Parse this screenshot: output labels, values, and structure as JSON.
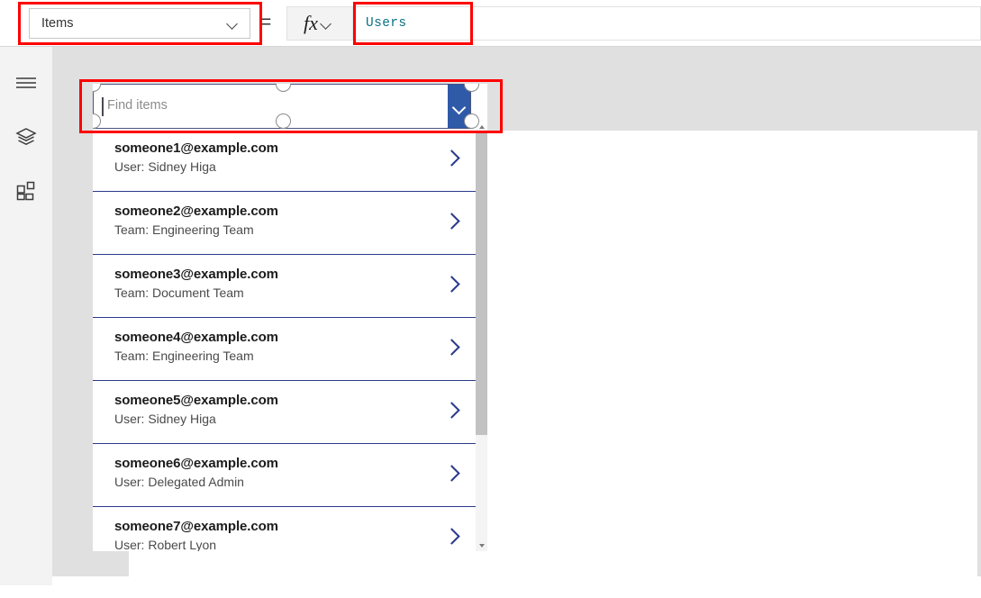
{
  "toolbar": {
    "property_label": "Items",
    "property_chevron_icon": "chevron-down-icon",
    "equals": "=",
    "fx_label": "fx",
    "fx_chevron_icon": "chevron-down-icon",
    "formula_value": "Users",
    "formula_color": "#0b7285"
  },
  "rail": {
    "items": [
      {
        "name": "menu",
        "icon": "hamburger-menu-icon"
      },
      {
        "name": "tree-view",
        "icon": "layers-icon"
      },
      {
        "name": "insert",
        "icon": "components-grid-icon"
      }
    ]
  },
  "list_control": {
    "search": {
      "placeholder": "Find items",
      "value": "",
      "dropdown_icon": "chevron-down-icon",
      "dropdown_color": "#2e5aa8",
      "selected": true
    },
    "row_chevron_icon": "chevron-right-icon",
    "separator_color": "#2b3a8c",
    "items": [
      {
        "title": "someone1@example.com",
        "subtitle": "User: Sidney Higa"
      },
      {
        "title": "someone2@example.com",
        "subtitle": "Team: Engineering Team"
      },
      {
        "title": "someone3@example.com",
        "subtitle": "Team: Document Team"
      },
      {
        "title": "someone4@example.com",
        "subtitle": "Team: Engineering Team"
      },
      {
        "title": "someone5@example.com",
        "subtitle": "User: Sidney Higa"
      },
      {
        "title": "someone6@example.com",
        "subtitle": "User: Delegated Admin"
      },
      {
        "title": "someone7@example.com",
        "subtitle": "User: Robert Lyon"
      }
    ],
    "scrollbar": {
      "up_arrow_icon": "triangle-up-icon",
      "down_arrow_icon": "triangle-down-icon"
    }
  },
  "annotations": {
    "color": "#ff0000",
    "boxes": [
      {
        "name": "property-dropdown-highlight"
      },
      {
        "name": "formula-input-highlight"
      },
      {
        "name": "search-box-highlight"
      }
    ]
  }
}
